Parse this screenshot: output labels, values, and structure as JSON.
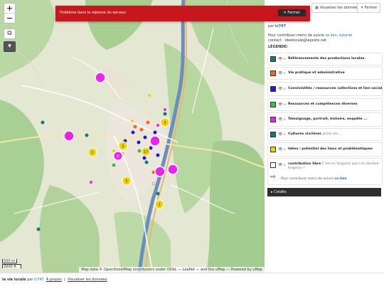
{
  "error": {
    "message": "Problème dans la réponse du serveur",
    "close_label": "✕ Fermer"
  },
  "toolbar": {
    "view_data_label": "Visualiser les données",
    "close_label": "Fermer"
  },
  "panel": {
    "credit_prefix": "par",
    "credit_user": "ic747",
    "intro_text": "Pour contribuer merci de suivre",
    "intro_link": "ce lien",
    "intro_tail": ", tutoriel",
    "contact": "contact : ideelocale@laposte.net",
    "legend_title": "LÉGENDE:",
    "layers": [
      {
        "color": "#117a7a",
        "label": "Référencements des productions locales.",
        "note": ""
      },
      {
        "color": "#f26b1d",
        "label": "Vie pratique et administrative",
        "note": ""
      },
      {
        "color": "#1d1dd8",
        "label": "Convivialités / ressources collectives et lien social",
        "note": ""
      },
      {
        "color": "#3cc33c",
        "label": "Ressources et compétences diverses",
        "note": ""
      },
      {
        "color": "#ee22ee",
        "label": "Témoignage, portrait, histoire, enquête ...",
        "note": ""
      },
      {
        "color": "#117a7a",
        "label": "Cultures vivrières",
        "note": "jardin etc..."
      },
      {
        "color": "#f2d200",
        "label": "Idées / potentiel des lieux et problématiques",
        "note": ""
      },
      {
        "color": "#ffffff",
        "label": "contribution libre",
        "note": "C'est en forgeant que l'on devient forgeron !"
      }
    ],
    "contrib_text": "Pour contribuer merci de suivre",
    "contrib_link": "ce lien",
    "credits_label": "Crédits"
  },
  "map": {
    "zoom_in": "+",
    "zoom_out": "−",
    "scale_m": "500 m",
    "scale_ft": "2000 ft",
    "attribution": "Map data © OpenStreetMap contributors under ODbL — Leaflet — and the uMap — Powered by uMap",
    "clusters": [
      {
        "count": "3",
        "color": "#f2d200"
      },
      {
        "count": "2",
        "color": "#f2d200"
      },
      {
        "count": "2",
        "color": "#f2d200"
      },
      {
        "count": "17",
        "color": "#f2d200"
      },
      {
        "count": "5",
        "color": "#f2d200"
      },
      {
        "count": "2",
        "color": "#f2d200"
      },
      {
        "count": "6",
        "color": "#ee22ee"
      }
    ]
  },
  "footer": {
    "title": "la vie locale",
    "by": "par",
    "user": "ic747",
    "about": "À propos",
    "sep": "|",
    "view_data": "Visualiser les données"
  }
}
